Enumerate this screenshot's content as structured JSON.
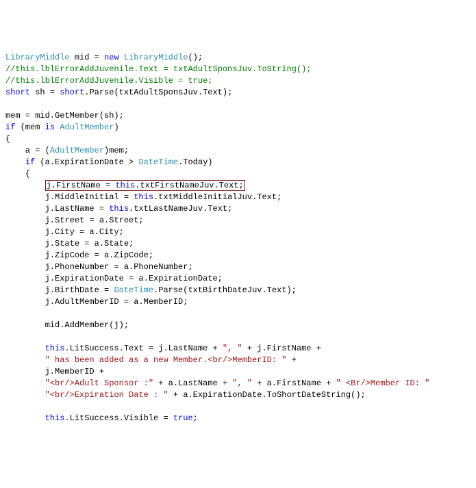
{
  "code": {
    "l01_a": "LibraryMiddle",
    "l01_b": " mid = ",
    "l01_c": "new",
    "l01_d": " ",
    "l01_e": "LibraryMiddle",
    "l01_f": "();",
    "l02": "//this.lblErrorAddJuvenile.Text = txtAdultSponsJuv.ToString();",
    "l03": "//this.lblErrorAddJuvenile.Visible = true;",
    "l04_a": "short",
    "l04_b": " sh = ",
    "l04_c": "short",
    "l04_d": ".Parse(txtAdultSponsJuv.Text);",
    "l06_a": "mem = mid.GetMember(sh);",
    "l07_a": "if",
    "l07_b": " (mem ",
    "l07_c": "is",
    "l07_d": " ",
    "l07_e": "AdultMember",
    "l07_f": ")",
    "l08": "{",
    "l09_a": "    a = (",
    "l09_b": "AdultMember",
    "l09_c": ")mem;",
    "l10_a": "    ",
    "l10_b": "if",
    "l10_c": " (a.ExpirationDate > ",
    "l10_d": "DateTime",
    "l10_e": ".Today)",
    "l11": "    {",
    "l12_a": "        ",
    "l12_b": "j.FirstName = ",
    "l12_c": "this",
    "l12_d": ".txtFirstNameJuv.Text;",
    "l13_a": "        j.MiddleInitial = ",
    "l13_b": "this",
    "l13_c": ".txtMiddleInitialJuv.Text;",
    "l14_a": "        j.LastName = ",
    "l14_b": "this",
    "l14_c": ".txtLastNameJuv.Text;",
    "l15": "        j.Street = a.Street;",
    "l16": "        j.City = a.City;",
    "l17": "        j.State = a.State;",
    "l18": "        j.ZipCode = a.ZipCode;",
    "l19": "        j.PhoneNumber = a.PhoneNumber;",
    "l20": "        j.ExpirationDate = a.ExpirationDate;",
    "l21_a": "        j.BirthDate = ",
    "l21_b": "DateTime",
    "l21_c": ".Parse(txtBirthDateJuv.Text);",
    "l22": "        j.AdultMemberID = a.MemberID;",
    "l24": "        mid.AddMember(j);",
    "l26_a": "        ",
    "l26_b": "this",
    "l26_c": ".LitSuccess.Text = j.LastName + ",
    "l26_d": "\", \"",
    "l26_e": " + j.FirstName +",
    "l27_a": "        ",
    "l27_b": "\" has been added as a new Member.<br/>MemberID: \"",
    "l27_c": " +",
    "l28": "        j.MemberID +",
    "l29_a": "        ",
    "l29_b": "\"<br/>Adult Sponsor :\"",
    "l29_c": " + a.LastName + ",
    "l29_d": "\", \"",
    "l29_e": " + a.FirstName + ",
    "l29_f": "\" <Br/>Member ID: \"",
    "l30_a": "        ",
    "l30_b": "\"<br/>Expiration Date : \"",
    "l30_c": " + a.ExpirationDate.ToShortDateString();",
    "l32_a": "        ",
    "l32_b": "this",
    "l32_c": ".LitSuccess.Visible = ",
    "l32_d": "true",
    "l32_e": ";"
  }
}
